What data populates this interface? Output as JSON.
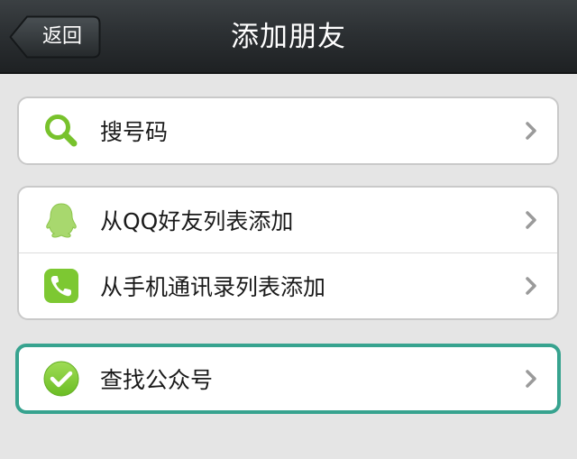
{
  "header": {
    "back_label": "返回",
    "title": "添加朋友"
  },
  "groups": [
    {
      "items": [
        {
          "label": "搜号码",
          "icon": "search-icon"
        }
      ]
    },
    {
      "items": [
        {
          "label": "从QQ好友列表添加",
          "icon": "qq-icon"
        },
        {
          "label": "从手机通讯录列表添加",
          "icon": "phone-icon"
        }
      ]
    },
    {
      "highlighted": true,
      "items": [
        {
          "label": "查找公众号",
          "icon": "check-circle-icon"
        }
      ]
    }
  ],
  "colors": {
    "navbar": "#2c3033",
    "background": "#e5e5e5",
    "icon_green": "#7dc832",
    "highlight_border": "#37a38f"
  }
}
